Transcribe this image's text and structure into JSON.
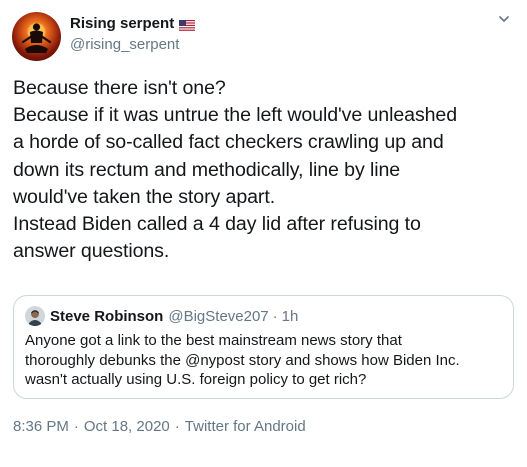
{
  "author": {
    "display_name": "Rising serpent",
    "handle": "@rising_serpent",
    "flag_icon": "us-flag-icon"
  },
  "tweet": {
    "lines": [
      "Because there isn't one?",
      "Because if it was untrue the left would've unleashed",
      "a horde of so-called fact checkers crawling up and",
      "down its rectum and methodically, line by line",
      "would've taken the story apart.",
      "Instead Biden called a 4 day lid after refusing to",
      "answer questions."
    ]
  },
  "quote": {
    "display_name": "Steve Robinson",
    "handle": "@BigSteve207",
    "separator": "·",
    "time": "1h",
    "lines": [
      "Anyone got a link to the best mainstream news story that",
      "thoroughly debunks the @nypost story and shows how Biden Inc.",
      "wasn't actually using U.S. foreign policy to get rich?"
    ]
  },
  "meta": {
    "time": "8:36 PM",
    "separator": "·",
    "date": "Oct 18, 2020",
    "separator2": "·",
    "source": "Twitter for Android"
  },
  "colors": {
    "text": "#14171a",
    "secondary": "#657786",
    "border": "#ccd6dd"
  }
}
